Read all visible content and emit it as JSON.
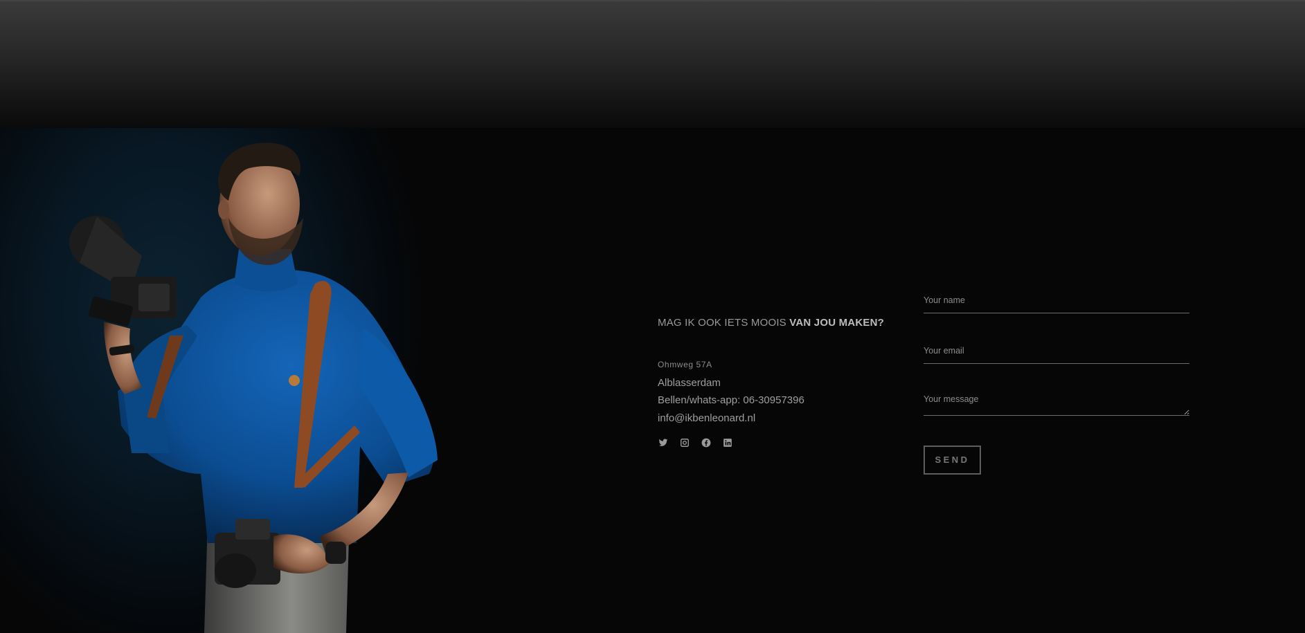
{
  "contact": {
    "tagline_plain": "MAG IK OOK IETS MOOIS ",
    "tagline_bold": "VAN JOU MAKEN?",
    "street": "Ohmweg 57A",
    "city": "Alblasserdam",
    "phone": "Bellen/whats-app: 06-30957396",
    "email": "info@ikbenleonard.nl",
    "socials": [
      {
        "icon": "twitter-icon"
      },
      {
        "icon": "instagram-icon"
      },
      {
        "icon": "facebook-icon"
      },
      {
        "icon": "linkedin-icon"
      }
    ]
  },
  "form": {
    "name_placeholder": "Your name",
    "email_placeholder": "Your email",
    "message_placeholder": "Your message",
    "send_label": "SEND"
  },
  "colors": {
    "background": "#060606",
    "text": "#9f9f9f",
    "border": "#6e6e6e",
    "shirt": "#0a4f94",
    "strap": "#9b4e22"
  }
}
